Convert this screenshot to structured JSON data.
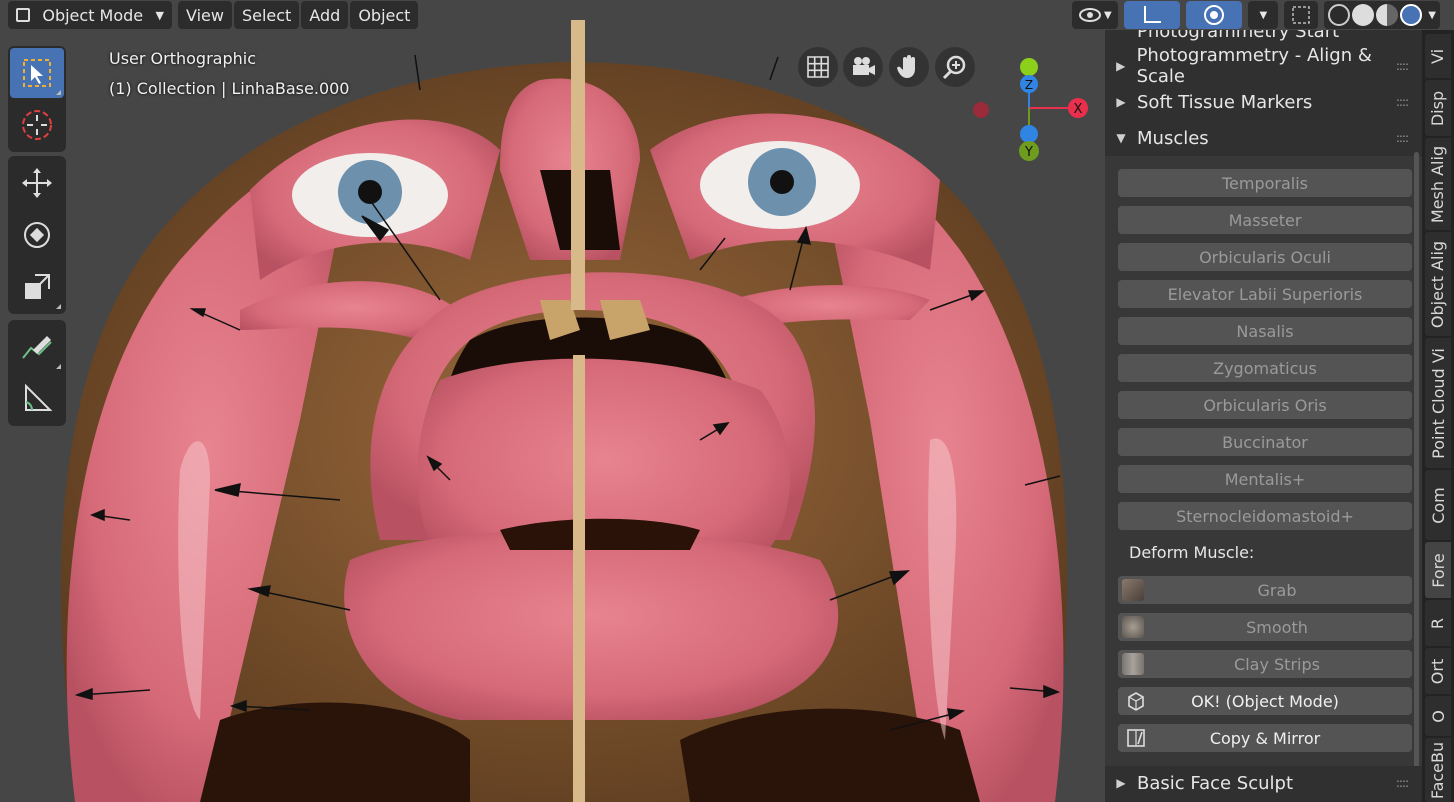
{
  "header": {
    "mode_label": "Object Mode",
    "menus": [
      "View",
      "Select",
      "Add",
      "Object"
    ]
  },
  "overlay": {
    "view_name": "User Orthographic",
    "collection_info": "(1) Collection | LinhaBase.000"
  },
  "gizmo": {
    "x": "X",
    "y": "Y",
    "z": "Z"
  },
  "panel": {
    "partial_header": "Photogrammetry Start",
    "sections": {
      "align": "Photogrammetry - Align & Scale",
      "soft_tissue": "Soft Tissue Markers",
      "muscles": "Muscles",
      "basic": "Basic Face Sculpt"
    },
    "muscle_buttons": [
      "Temporalis",
      "Masseter",
      "Orbicularis Oculi",
      "Elevator Labii Superioris",
      "Nasalis",
      "Zygomaticus",
      "Orbicularis Oris",
      "Buccinator",
      "Mentalis+",
      "Sternocleidomastoid+"
    ],
    "deform_label": "Deform Muscle:",
    "deform_buttons": [
      "Grab",
      "Smooth",
      "Clay Strips"
    ],
    "ok_label": "OK! (Object Mode)",
    "copy_label": "Copy & Mirror"
  },
  "tabs": [
    "Vi",
    "Disp",
    "Mesh Alig",
    "Object Alig",
    "Point Cloud Vi",
    "Com",
    "Fore",
    "R",
    "Ort",
    "O",
    "FaceBu"
  ],
  "colors": {
    "accent": "#4772b3",
    "skin": "#d9727f",
    "axis_x": "#e8304d",
    "axis_y": "#6e9c1f",
    "axis_z": "#2f84e4"
  }
}
